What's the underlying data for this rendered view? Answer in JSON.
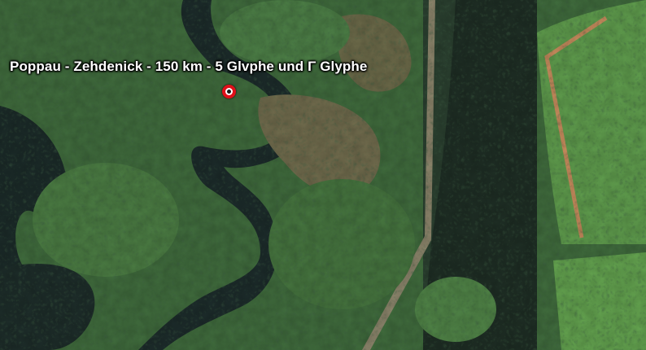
{
  "placemark": {
    "label": "Poppau - Zehdenick - 150 km - 5 Glvphe und Γ Glyphe",
    "icon": "red-circle-marker"
  },
  "imagery": {
    "type": "satellite",
    "features": [
      "river",
      "forest",
      "wetland",
      "farm-fields",
      "dirt-track"
    ]
  }
}
